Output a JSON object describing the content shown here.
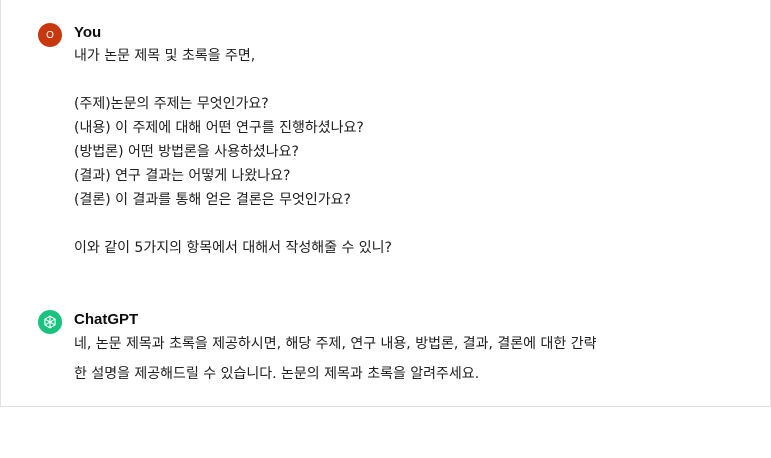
{
  "user_message": {
    "author": "You",
    "avatar_initial": "O",
    "avatar_color": "#c8380f",
    "lines": [
      "내가 논문 제목 및 초록을 주면,",
      "",
      "(주제)논문의 주제는 무엇인가요?",
      "(내용) 이 주제에 대해 어떤 연구를 진행하셨나요?",
      "(방법론) 어떤 방법론을 사용하셨나요?",
      "(결과) 연구 결과는 어떻게 나왔나요?",
      "(결론) 이 결과를 통해 얻은 결론은 무엇인가요?",
      "",
      "이와 같이 5가지의 항목에서 대해서 작성해줄 수 있니?"
    ]
  },
  "assistant_message": {
    "author": "ChatGPT",
    "avatar_icon": "openai-logo-icon",
    "avatar_color": "#19c37d",
    "lines": [
      "네, 논문 제목과 초록을 제공하시면, 해당 주제, 연구 내용, 방법론, 결과, 결론에 대한 간략",
      "한 설명을 제공해드릴 수 있습니다. 논문의 제목과 초록을 알려주세요."
    ]
  }
}
